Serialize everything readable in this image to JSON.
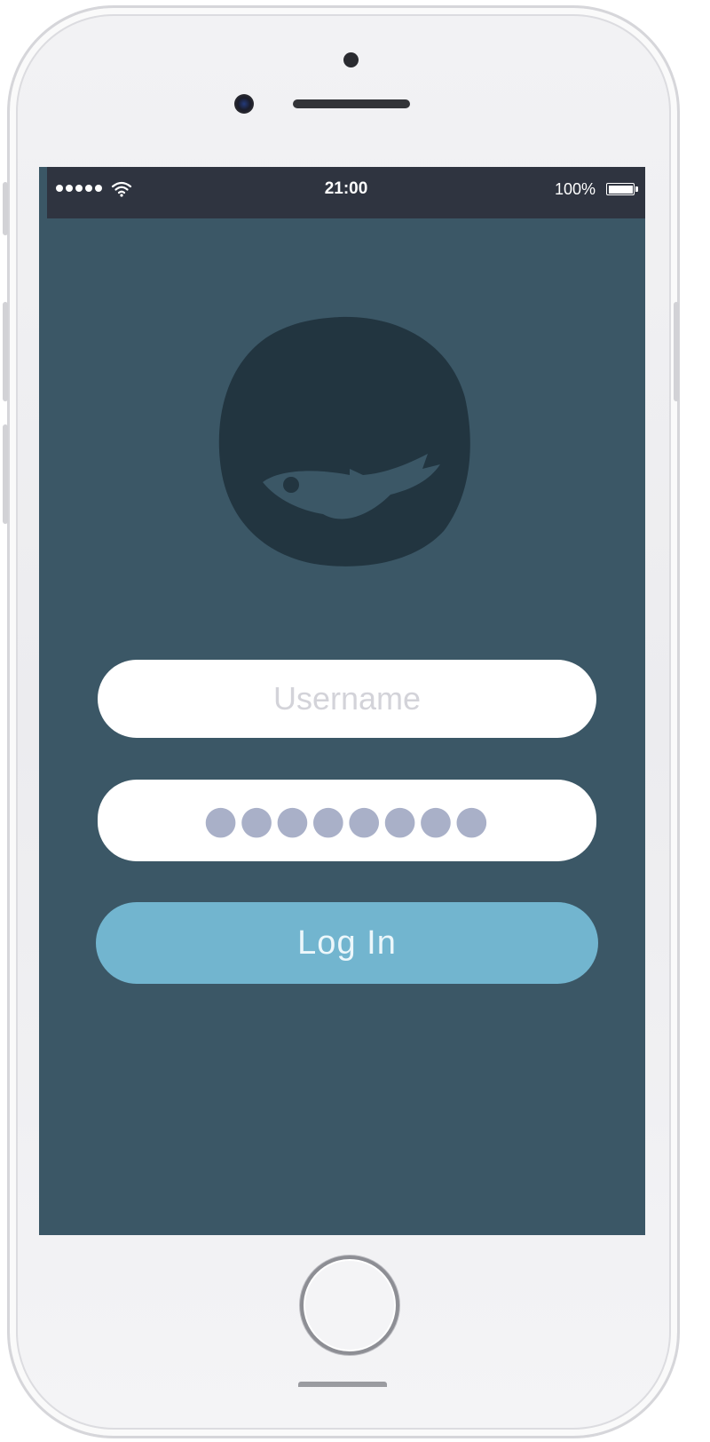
{
  "status_bar": {
    "time": "21:00",
    "battery_percent": "100%",
    "signal_bars": 5,
    "icons": [
      "signal-dots-icon",
      "wifi-icon",
      "battery-icon"
    ]
  },
  "app": {
    "logo_icon": "fish-logo-icon",
    "username": {
      "placeholder": "Username",
      "value": ""
    },
    "password": {
      "masked_value": "●●●●●●●●"
    },
    "login_button": "Log In"
  },
  "colors": {
    "screen_background": "#3b5766",
    "status_bar": "#2f3440",
    "logo": "#223540",
    "button": "#72b5cf",
    "input_background": "#ffffff",
    "password_dots": "#a9b0c8"
  }
}
